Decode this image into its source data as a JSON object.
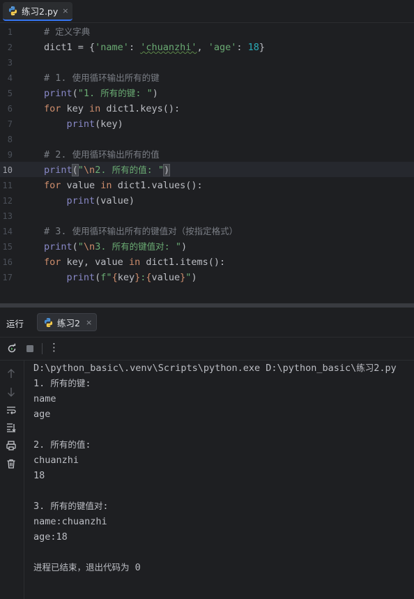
{
  "editor_tab": {
    "label": "练习2.py",
    "close": "×"
  },
  "editor": {
    "line_numbers": [
      "1",
      "2",
      "3",
      "4",
      "5",
      "6",
      "7",
      "8",
      "9",
      "10",
      "11",
      "12",
      "13",
      "14",
      "15",
      "16",
      "17"
    ],
    "active_line": "10",
    "lines": [
      [
        {
          "t": "# 定义字典",
          "c": "cm"
        }
      ],
      [
        {
          "t": "dict1 = {",
          "c": ""
        },
        {
          "t": "'name'",
          "c": "str"
        },
        {
          "t": ": ",
          "c": ""
        },
        {
          "t": "'chuanzhi'",
          "c": "str-wavy"
        },
        {
          "t": ", ",
          "c": ""
        },
        {
          "t": "'age'",
          "c": "str"
        },
        {
          "t": ": ",
          "c": ""
        },
        {
          "t": "18",
          "c": "num"
        },
        {
          "t": "}",
          "c": ""
        }
      ],
      [],
      [
        {
          "t": "# 1. 使用循环输出所有的键",
          "c": "cm"
        }
      ],
      [
        {
          "t": "print",
          "c": "bi"
        },
        {
          "t": "(",
          "c": ""
        },
        {
          "t": "\"1. 所有的键: \"",
          "c": "str"
        },
        {
          "t": ")",
          "c": ""
        }
      ],
      [
        {
          "t": "for",
          "c": "kw"
        },
        {
          "t": " key ",
          "c": ""
        },
        {
          "t": "in",
          "c": "kw"
        },
        {
          "t": " dict1.keys():",
          "c": ""
        }
      ],
      [
        {
          "t": "    ",
          "c": ""
        },
        {
          "t": "print",
          "c": "bi"
        },
        {
          "t": "(key)",
          "c": ""
        }
      ],
      [],
      [
        {
          "t": "# 2. 使用循环输出所有的值",
          "c": "cm"
        }
      ],
      [
        {
          "t": "print",
          "c": "bi"
        },
        {
          "t": "(",
          "c": "match"
        },
        {
          "t": "\"",
          "c": "str"
        },
        {
          "t": "\\n",
          "c": "esc"
        },
        {
          "t": "2. 所有的值: \"",
          "c": "str"
        },
        {
          "t": ")",
          "c": "match"
        }
      ],
      [
        {
          "t": "for",
          "c": "kw"
        },
        {
          "t": " value ",
          "c": ""
        },
        {
          "t": "in",
          "c": "kw"
        },
        {
          "t": " dict1.values():",
          "c": ""
        }
      ],
      [
        {
          "t": "    ",
          "c": ""
        },
        {
          "t": "print",
          "c": "bi"
        },
        {
          "t": "(value)",
          "c": ""
        }
      ],
      [],
      [
        {
          "t": "# 3. 使用循环输出所有的键值对（按指定格式）",
          "c": "cm"
        }
      ],
      [
        {
          "t": "print",
          "c": "bi"
        },
        {
          "t": "(",
          "c": ""
        },
        {
          "t": "\"",
          "c": "str"
        },
        {
          "t": "\\n",
          "c": "esc"
        },
        {
          "t": "3. 所有的键值对: \"",
          "c": "str"
        },
        {
          "t": ")",
          "c": ""
        }
      ],
      [
        {
          "t": "for",
          "c": "kw"
        },
        {
          "t": " key, value ",
          "c": ""
        },
        {
          "t": "in",
          "c": "kw"
        },
        {
          "t": " dict1.items():",
          "c": ""
        }
      ],
      [
        {
          "t": "    ",
          "c": ""
        },
        {
          "t": "print",
          "c": "bi"
        },
        {
          "t": "(",
          "c": ""
        },
        {
          "t": "f\"",
          "c": "str"
        },
        {
          "t": "{",
          "c": "brace"
        },
        {
          "t": "key",
          "c": ""
        },
        {
          "t": "}",
          "c": "brace"
        },
        {
          "t": ":",
          "c": "str"
        },
        {
          "t": "{",
          "c": "brace"
        },
        {
          "t": "value",
          "c": ""
        },
        {
          "t": "}",
          "c": "brace"
        },
        {
          "t": "\"",
          "c": "str"
        },
        {
          "t": ")",
          "c": ""
        }
      ]
    ]
  },
  "run_panel": {
    "title": "运行",
    "tab_label": "练习2",
    "tab_close": "×",
    "more_label": "⋮"
  },
  "console": {
    "lines": [
      "D:\\python_basic\\.venv\\Scripts\\python.exe D:\\python_basic\\练习2.py",
      "1. 所有的键:",
      "name",
      "age",
      "",
      "2. 所有的值:",
      "chuanzhi",
      "18",
      "",
      "3. 所有的键值对:",
      "name:chuanzhi",
      "age:18",
      "",
      "进程已结束，退出代码为 0"
    ]
  },
  "icons": {
    "tab_file": "python-file-icon",
    "rerun": "rerun-icon",
    "stop": "stop-icon",
    "scroll_up": "arrow-up-icon",
    "scroll_down": "arrow-down-icon",
    "soft_wrap": "soft-wrap-icon",
    "scroll_to_end": "scroll-to-end-icon",
    "print": "print-icon",
    "clear": "trash-icon"
  },
  "colors": {
    "keyword": "#cf8e6d",
    "string": "#6aab73",
    "number": "#2aacb8",
    "builtin": "#8888c6",
    "comment": "#7a7e85",
    "accent": "#3574f0"
  }
}
